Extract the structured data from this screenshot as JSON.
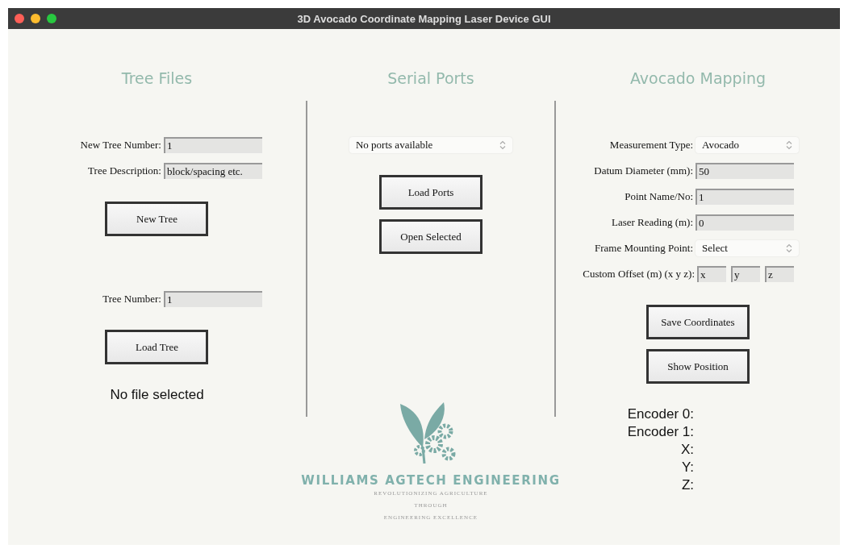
{
  "window": {
    "title": "3D Avocado Coordinate Mapping Laser Device GUI"
  },
  "tree_files": {
    "title": "Tree Files",
    "new_tree_fields": [
      {
        "label": "New Tree Number:",
        "value": "1"
      },
      {
        "label": "Tree Description:",
        "value": "block/spacing etc."
      }
    ],
    "new_tree_button": "New Tree",
    "load_field": {
      "label": "Tree Number:",
      "value": "1"
    },
    "load_button": "Load Tree",
    "status": "No file selected"
  },
  "serial_ports": {
    "title": "Serial Ports",
    "port_select": {
      "value": "No ports available"
    },
    "buttons": [
      "Load Ports",
      "Open Selected"
    ]
  },
  "logo": {
    "company": "WILLIAMS AGTECH ENGINEERING",
    "tagline": [
      "REVOLUTIONIZING AGRICULTURE",
      "THROUGH",
      "ENGINEERING EXCELLENCE"
    ]
  },
  "avocado_mapping": {
    "title": "Avocado Mapping",
    "rows": [
      {
        "kind": "select",
        "label": "Measurement Type:",
        "value": "Avocado"
      },
      {
        "kind": "field",
        "label": "Datum Diameter (mm):",
        "value": "50"
      },
      {
        "kind": "field",
        "label": "Point Name/No:",
        "value": "1"
      },
      {
        "kind": "field",
        "label": "Laser Reading (m):",
        "value": "0"
      },
      {
        "kind": "select",
        "label": "Frame Mounting Point:",
        "value": "Select"
      },
      {
        "kind": "xyz",
        "label": "Custom Offset (m) (x y z):",
        "values": [
          "x",
          "y",
          "z"
        ]
      }
    ],
    "buttons": [
      "Save Coordinates",
      "Show Position"
    ],
    "readouts": [
      "Encoder 0:",
      "Encoder 1:",
      "X:",
      "Y:",
      "Z:"
    ]
  }
}
